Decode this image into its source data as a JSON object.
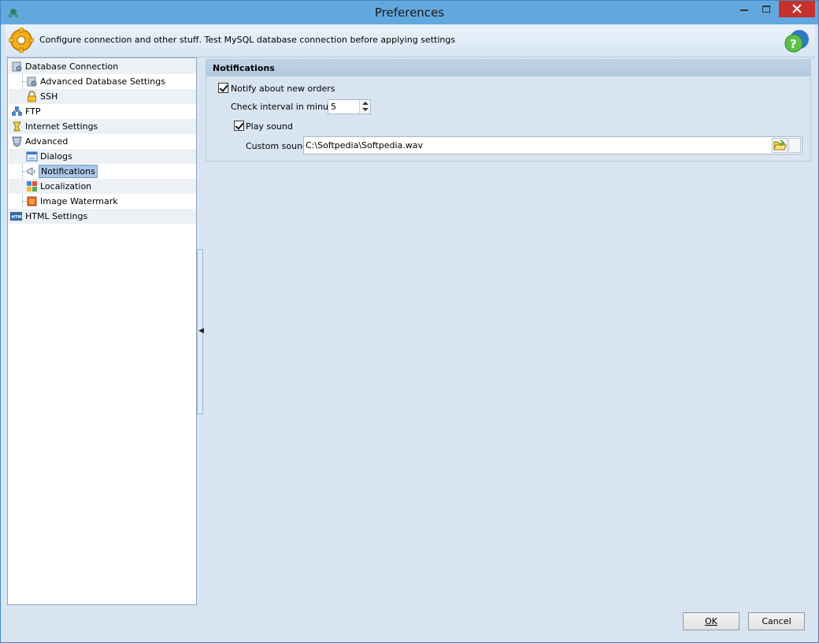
{
  "window": {
    "title": "Preferences"
  },
  "header": {
    "text": "Configure connection and other stuff. Test MySQL database connection before applying settings"
  },
  "tree": {
    "items": [
      {
        "label": "Database Connection",
        "icon": "database-icon"
      },
      {
        "label": "Advanced Database Settings",
        "icon": "database-settings-icon"
      },
      {
        "label": "SSH",
        "icon": "lock-icon"
      },
      {
        "label": "FTP",
        "icon": "network-icon"
      },
      {
        "label": "Internet Settings",
        "icon": "internet-icon"
      },
      {
        "label": "Advanced",
        "icon": "shield-icon"
      },
      {
        "label": "Dialogs",
        "icon": "dialog-icon"
      },
      {
        "label": "Notifications",
        "icon": "notification-icon",
        "selected": true
      },
      {
        "label": "Localization",
        "icon": "localization-icon"
      },
      {
        "label": "Image Watermark",
        "icon": "image-icon"
      },
      {
        "label": "HTML Settings",
        "icon": "html-icon"
      }
    ]
  },
  "notifications": {
    "group_title": "Notifications",
    "notify_label": "Notify about new orders",
    "notify_checked": true,
    "interval_label": "Check interval in minutes",
    "interval_value": "5",
    "play_sound_label": "Play sound",
    "play_sound_checked": true,
    "custom_sound_label": "Custom sound",
    "custom_sound_value": "C:\\Softpedia\\Softpedia.wav"
  },
  "footer": {
    "ok_label": "OK",
    "cancel_label": "Cancel"
  },
  "colors": {
    "titlebar": "#62a8de",
    "close": "#c7312b",
    "selection": "#a9c7e8"
  }
}
